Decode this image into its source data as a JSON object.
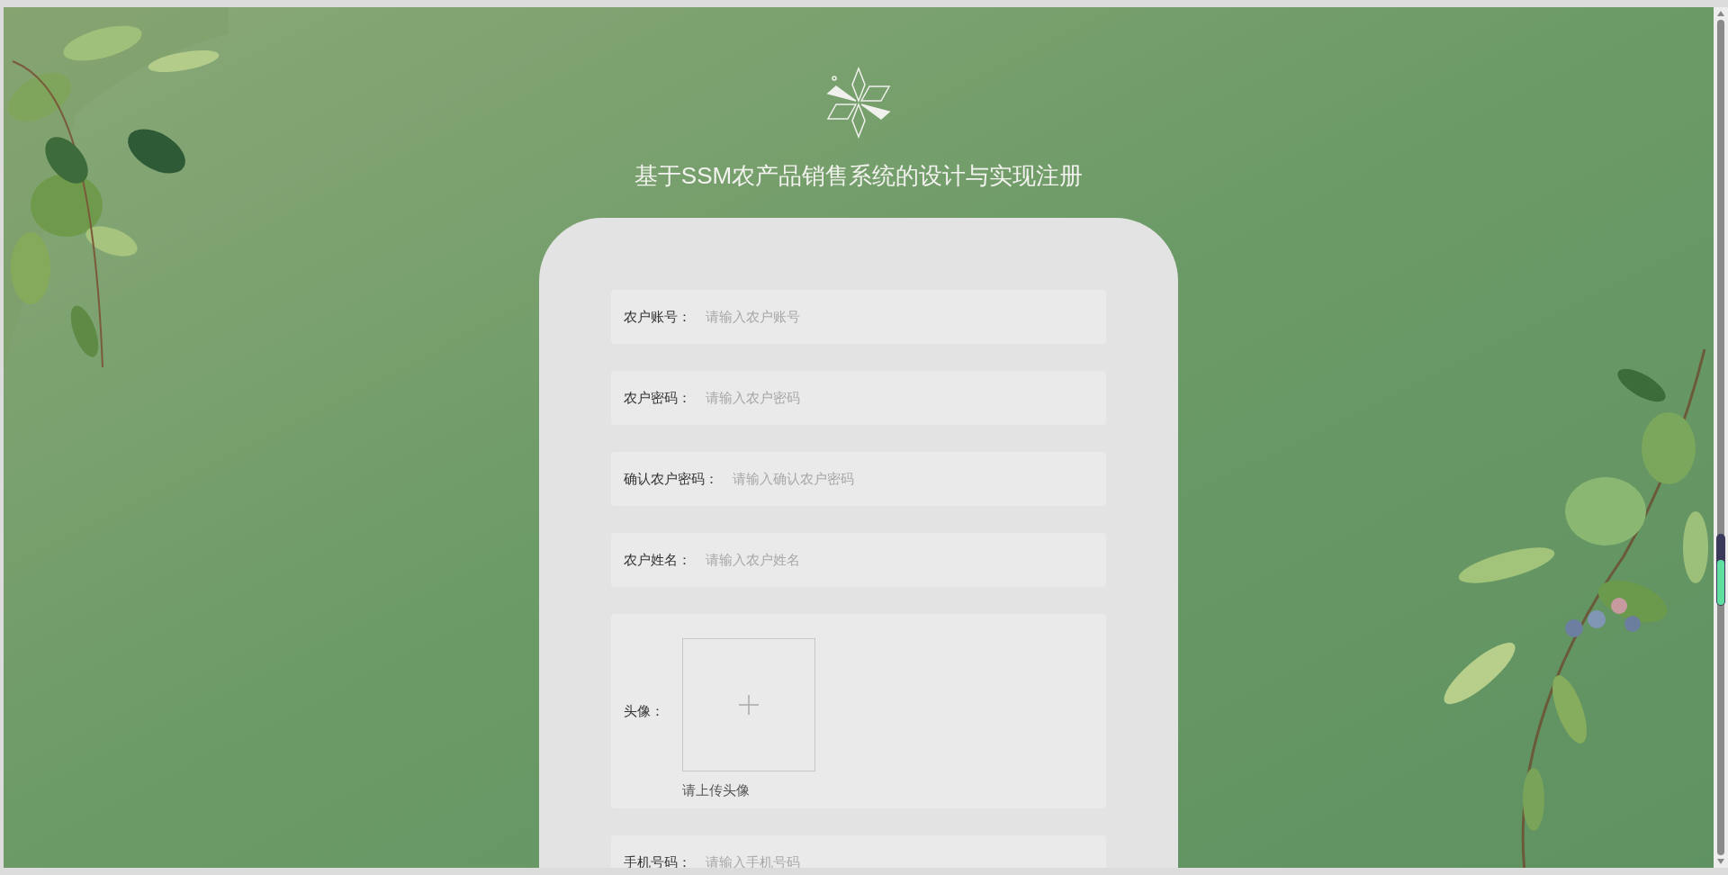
{
  "title": "基于SSM农产品销售系统的设计与实现注册",
  "fields": [
    {
      "kind": "text",
      "label": "农户账号：",
      "placeholder": "请输入农户账号"
    },
    {
      "kind": "text",
      "label": "农户密码：",
      "placeholder": "请输入农户密码"
    },
    {
      "kind": "text",
      "label": "确认农户密码：",
      "placeholder": "请输入确认农户密码"
    },
    {
      "kind": "text",
      "label": "农户姓名：",
      "placeholder": "请输入农户姓名"
    },
    {
      "kind": "upload",
      "label": "头像：",
      "hint": "请上传头像"
    },
    {
      "kind": "text",
      "label": "手机号码：",
      "placeholder": "请输入手机号码"
    }
  ]
}
